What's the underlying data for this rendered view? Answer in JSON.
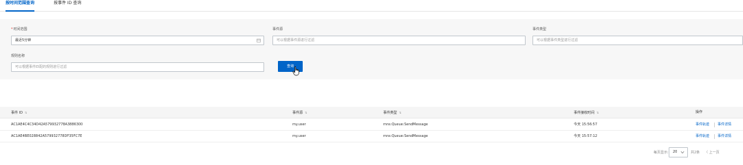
{
  "tabs": [
    {
      "label": "按时间范围查询",
      "active": true
    },
    {
      "label": "按事件 ID 查询",
      "active": false
    }
  ],
  "filters": {
    "time_range": {
      "label": "时间范围",
      "required_mark": "*",
      "value": "最近5分钟",
      "icon": "calendar-icon"
    },
    "event_source": {
      "label": "事件源",
      "placeholder": "可以根据事件源进行过滤"
    },
    "event_type": {
      "label": "事件类型",
      "placeholder": "可以根据事件类型进行过滤"
    },
    "rule_name": {
      "label": "规则名称",
      "placeholder": "可以根据事件匹配的规则进行过滤"
    },
    "search_button": "查询"
  },
  "table": {
    "sort_icon": "sort-icon",
    "sort_glyph": "⇅",
    "columns": [
      "事件 ID",
      "事件源",
      "事件类型",
      "事件接收时间",
      "操作"
    ],
    "rows": [
      {
        "id": "AC1AE4C4C34D42A579932778A3886300",
        "source": "my.user",
        "type": "mns:Queue:SendMessage",
        "time": "今天 15:56:57",
        "action_trace": "事件轨迹",
        "action_detail": "事件详情"
      },
      {
        "id": "AC1AE4BE028842A579932778DF35FC7E",
        "source": "my.user",
        "type": "mns:Queue:SendMessage",
        "time": "今天 15:57:12",
        "action_trace": "事件轨迹",
        "action_detail": "事件详情"
      }
    ]
  },
  "pagination": {
    "page_size_label": "每页显示:",
    "page_size": "20",
    "total": "共2条",
    "prev": "〈 上一页"
  },
  "colors": {
    "accent": "#0064c8",
    "required": "#d93026"
  }
}
